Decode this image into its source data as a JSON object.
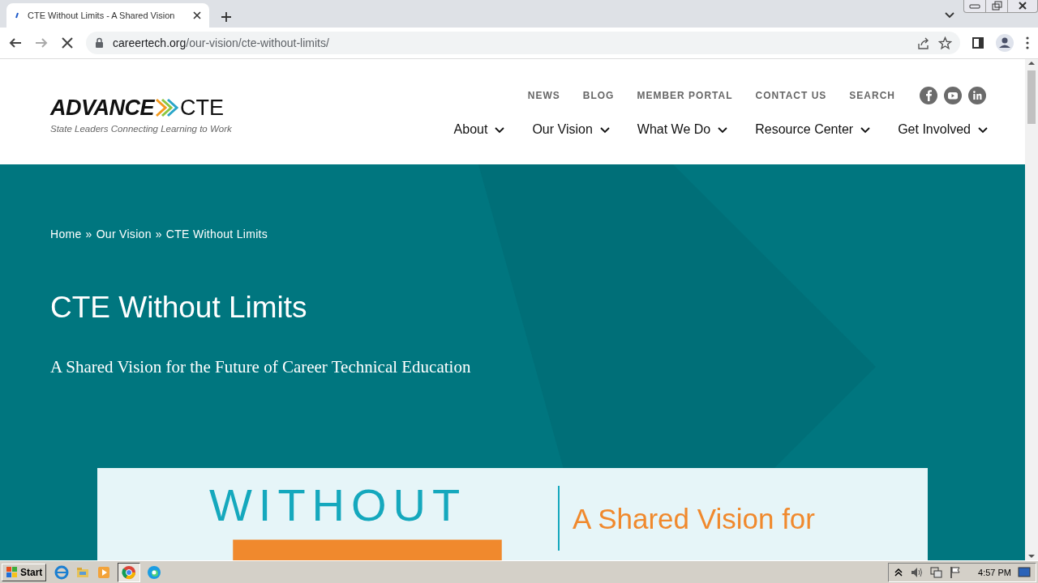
{
  "browser": {
    "tab_title": "CTE Without Limits - A Shared Vision",
    "url_host": "careertech.org",
    "url_path": "/our-vision/cte-without-limits/"
  },
  "header": {
    "logo": {
      "wordmark": "ADVANCE",
      "suffix": "CTE",
      "tagline": "State Leaders Connecting Learning to Work"
    },
    "utility_links": [
      "NEWS",
      "BLOG",
      "MEMBER PORTAL",
      "CONTACT US",
      "SEARCH"
    ],
    "main_nav": [
      {
        "label": "About"
      },
      {
        "label": "Our Vision"
      },
      {
        "label": "What We Do"
      },
      {
        "label": "Resource Center"
      },
      {
        "label": "Get Involved"
      }
    ]
  },
  "hero": {
    "breadcrumb": [
      {
        "label": "Home"
      },
      {
        "label": "Our Vision"
      },
      {
        "label": "CTE Without Limits"
      }
    ],
    "separator": "»",
    "title": "CTE Without Limits",
    "subtitle": "A Shared Vision for the Future of Career Technical Education"
  },
  "banner": {
    "heading": "WITHOUT",
    "tagline": "A Shared Vision for"
  },
  "taskbar": {
    "start": "Start",
    "clock": "4:57 PM"
  }
}
